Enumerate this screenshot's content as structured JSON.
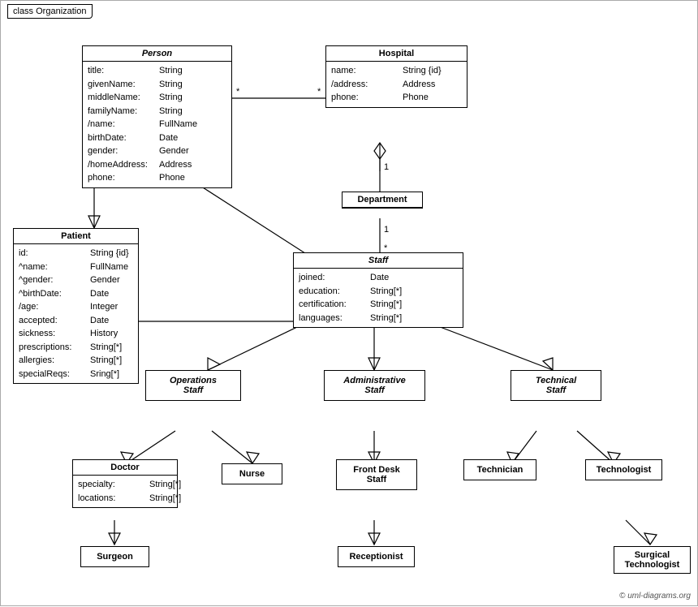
{
  "diagram": {
    "title": "class Organization",
    "copyright": "© uml-diagrams.org",
    "classes": {
      "person": {
        "name": "Person",
        "italic": true,
        "attrs": [
          {
            "name": "title:",
            "type": "String"
          },
          {
            "name": "givenName:",
            "type": "String"
          },
          {
            "name": "middleName:",
            "type": "String"
          },
          {
            "name": "familyName:",
            "type": "String"
          },
          {
            "name": "/name:",
            "type": "FullName"
          },
          {
            "name": "birthDate:",
            "type": "Date"
          },
          {
            "name": "gender:",
            "type": "Gender"
          },
          {
            "name": "/homeAddress:",
            "type": "Address"
          },
          {
            "name": "phone:",
            "type": "Phone"
          }
        ]
      },
      "hospital": {
        "name": "Hospital",
        "italic": false,
        "attrs": [
          {
            "name": "name:",
            "type": "String {id}"
          },
          {
            "name": "/address:",
            "type": "Address"
          },
          {
            "name": "phone:",
            "type": "Phone"
          }
        ]
      },
      "department": {
        "name": "Department",
        "italic": false,
        "attrs": []
      },
      "staff": {
        "name": "Staff",
        "italic": true,
        "attrs": [
          {
            "name": "joined:",
            "type": "Date"
          },
          {
            "name": "education:",
            "type": "String[*]"
          },
          {
            "name": "certification:",
            "type": "String[*]"
          },
          {
            "name": "languages:",
            "type": "String[*]"
          }
        ]
      },
      "patient": {
        "name": "Patient",
        "italic": false,
        "attrs": [
          {
            "name": "id:",
            "type": "String {id}"
          },
          {
            "name": "^name:",
            "type": "FullName"
          },
          {
            "name": "^gender:",
            "type": "Gender"
          },
          {
            "name": "^birthDate:",
            "type": "Date"
          },
          {
            "name": "/age:",
            "type": "Integer"
          },
          {
            "name": "accepted:",
            "type": "Date"
          },
          {
            "name": "sickness:",
            "type": "History"
          },
          {
            "name": "prescriptions:",
            "type": "String[*]"
          },
          {
            "name": "allergies:",
            "type": "String[*]"
          },
          {
            "name": "specialReqs:",
            "type": "Sring[*]"
          }
        ]
      },
      "operations_staff": {
        "name": "Operations Staff",
        "italic": true
      },
      "administrative_staff": {
        "name": "Administrative Staff",
        "italic": true
      },
      "technical_staff": {
        "name": "Technical Staff",
        "italic": true
      },
      "doctor": {
        "name": "Doctor",
        "italic": false,
        "attrs": [
          {
            "name": "specialty:",
            "type": "String[*]"
          },
          {
            "name": "locations:",
            "type": "String[*]"
          }
        ]
      },
      "nurse": {
        "name": "Nurse",
        "italic": false
      },
      "front_desk_staff": {
        "name": "Front Desk Staff",
        "italic": false
      },
      "technician": {
        "name": "Technician",
        "italic": false
      },
      "technologist": {
        "name": "Technologist",
        "italic": false
      },
      "surgeon": {
        "name": "Surgeon",
        "italic": false
      },
      "receptionist": {
        "name": "Receptionist",
        "italic": false
      },
      "surgical_technologist": {
        "name": "Surgical Technologist",
        "italic": false
      }
    }
  }
}
